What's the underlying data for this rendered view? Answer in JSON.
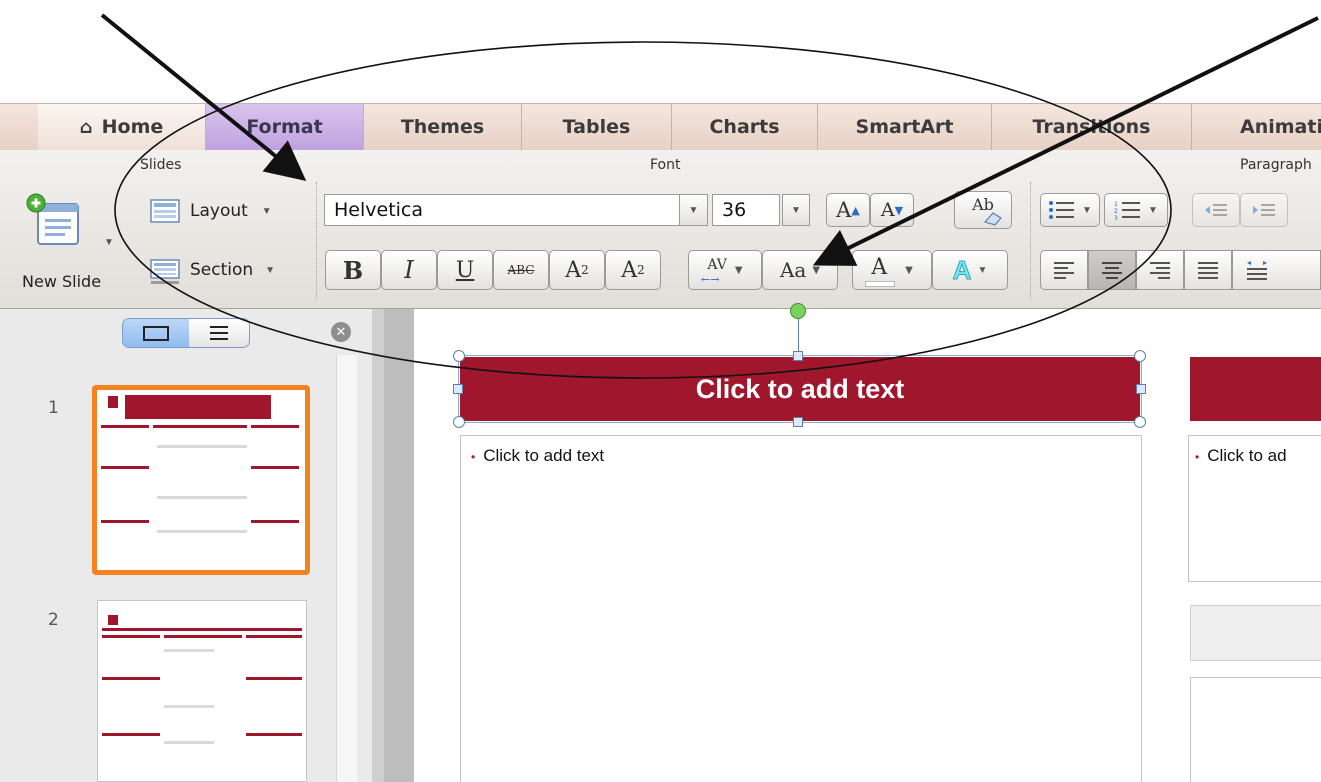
{
  "ribbon_tabs": {
    "home": "Home",
    "format": "Format",
    "themes": "Themes",
    "tables": "Tables",
    "charts": "Charts",
    "smartart": "SmartArt",
    "transitions": "Transitions",
    "animations": "Animati"
  },
  "groups": {
    "slides": "Slides",
    "font": "Font",
    "paragraph": "Paragraph"
  },
  "slides_group": {
    "new_slide": "New Slide",
    "layout": "Layout",
    "section": "Section"
  },
  "font_group": {
    "font_name": "Helvetica",
    "font_size": "36",
    "bold": "B",
    "italic": "I",
    "underline": "U",
    "strikethrough": "ABC",
    "superscript_base": "A",
    "superscript_exp": "2",
    "subscript_base": "A",
    "subscript_exp": "2",
    "char_spacing": "AV",
    "change_case": "Aa",
    "font_color": "A",
    "text_effects": "A",
    "grow": "A",
    "shrink": "A",
    "clear_format": "Ab"
  },
  "slide_thumbnails": [
    {
      "number": "1",
      "selected": true
    },
    {
      "number": "2",
      "selected": false
    }
  ],
  "slide": {
    "title_placeholder": "Click to add text",
    "body_placeholder": "Click to add text",
    "right_body_placeholder": "Click to ad"
  },
  "colors": {
    "title_bar": "#a0162d",
    "selection_orange": "#f58220",
    "format_tab": "#c7aee6"
  }
}
